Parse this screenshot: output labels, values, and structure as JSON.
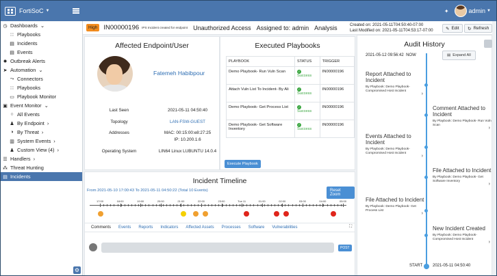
{
  "app": {
    "brand": "FortiSoC",
    "user": "admin"
  },
  "sidebar": {
    "items": [
      {
        "label": "Dashboards",
        "icon": "dashboard-icon",
        "sub": false,
        "active": false
      },
      {
        "label": "Playbooks",
        "icon": "playbooks-icon",
        "sub": true,
        "active": false
      },
      {
        "label": "Incidents",
        "icon": "incidents-icon",
        "sub": true,
        "active": false
      },
      {
        "label": "Events",
        "icon": "events-icon",
        "sub": true,
        "active": false
      },
      {
        "label": "Outbreak Alerts",
        "icon": "outbreak-icon",
        "sub": false,
        "active": false
      },
      {
        "label": "Automation",
        "icon": "automation-icon",
        "sub": false,
        "active": false
      },
      {
        "label": "Connectors",
        "icon": "connectors-icon",
        "sub": true,
        "active": false
      },
      {
        "label": "Playbooks",
        "icon": "playbooks-icon",
        "sub": true,
        "active": false
      },
      {
        "label": "Playbook Monitor",
        "icon": "monitor-icon",
        "sub": true,
        "active": false
      },
      {
        "label": "Event Monitor",
        "icon": "event-monitor-icon",
        "sub": false,
        "active": false
      },
      {
        "label": "All Events",
        "icon": "circle-icon",
        "sub": true,
        "active": false
      },
      {
        "label": "By Endpoint",
        "icon": "endpoint-icon",
        "sub": true,
        "active": false
      },
      {
        "label": "By Threat",
        "icon": "threat-icon",
        "sub": true,
        "active": false
      },
      {
        "label": "System Events",
        "icon": "system-events-icon",
        "sub": true,
        "active": false
      },
      {
        "label": "Custom View (4)",
        "icon": "custom-view-icon",
        "sub": true,
        "active": false
      },
      {
        "label": "Handlers",
        "icon": "handlers-icon",
        "sub": false,
        "active": false
      },
      {
        "label": "Threat Hunting",
        "icon": "threat-hunting-icon",
        "sub": false,
        "active": false
      },
      {
        "label": "Incidents",
        "icon": "incidents-icon",
        "sub": false,
        "active": true
      }
    ]
  },
  "incident": {
    "severity": "High",
    "id": "IN00000196",
    "subtitle": "IPS Incident created for endpoint",
    "title": "Unauthorized Access",
    "assigned": "Assigned to: admin",
    "phase": "Analysis",
    "created": "Created on: 2021-05-11T04:50:40-07:00",
    "modified": "Last Modified on: 2021-05-11T04:53:17-07:00",
    "edit_label": "Edit",
    "refresh_label": "Refresh"
  },
  "endpoint": {
    "title": "Affected Endpoint/User",
    "name": "Fatemeh Habibpour",
    "fields": [
      {
        "key": "Last Seen",
        "value": "2021-05-11 04:50:40"
      },
      {
        "key": "Topology",
        "value": "LAN-FSW-GUEST"
      },
      {
        "key": "Addresses",
        "value": "MAC: 00:15:00:e8:27:25"
      },
      {
        "key": "",
        "value": "IP: 10.200.1.6"
      },
      {
        "key": "Operating System",
        "value": "LIN64 Linux LUBUNTU 14.0.4"
      }
    ]
  },
  "playbooks": {
    "title": "Executed Playbooks",
    "headers": [
      "PLAYBOOK",
      "STATUS",
      "TRIGGER"
    ],
    "rows": [
      {
        "playbook": "Demo Playbook- Run Vuln Scan",
        "status": "Success",
        "trigger": "IN00000196"
      },
      {
        "playbook": "Attach Vuln List To Incident- By Ali",
        "status": "Success",
        "trigger": "IN00000196"
      },
      {
        "playbook": "Demo Playbook- Get Process List",
        "status": "Success",
        "trigger": "IN00000196"
      },
      {
        "playbook": "Demo Playbook- Get Software Inventory",
        "status": "Success",
        "trigger": "IN00000196"
      }
    ],
    "execute_label": "Execute Playbook"
  },
  "timeline": {
    "title": "Incident Timeline",
    "range": "From 2021-05-10 17:00:43 To 2021-05-11 04:50:22 (Total 10 Events)",
    "reset_label": "Reset Zoom",
    "ticks": [
      "17:00",
      "18:00",
      "19:00",
      "20:00",
      "21:00",
      "22:00",
      "23:00",
      "Tue 11",
      "01:00",
      "02:00",
      "03:00",
      "04:00",
      "05:00"
    ],
    "colors": {
      "red": "#e0251b",
      "orange": "#f0a030",
      "yellow": "#f5d000"
    }
  },
  "tabs": [
    "Comments",
    "Events",
    "Reports",
    "Indicators",
    "Affected Assets",
    "Processes",
    "Software",
    "Vulnerabilities"
  ],
  "comment": {
    "post_label": "POST"
  },
  "audit": {
    "title": "Audit History",
    "now_time": "2021-05-12 09:56:42",
    "now_label": "NOW",
    "expand_label": "Expand All",
    "entries": [
      {
        "title": "Report Attached to Incident",
        "sub": "By Playbook: Demo Playbook- Compromised Host Incident"
      },
      {
        "title": "Comment Attached to Incident",
        "sub": "By Playbook: Demo Playbook- Run Vuln Scan"
      },
      {
        "title": "Events Attached to Incident",
        "sub": "By Playbook: Demo Playbook- Compromised Host Incident"
      },
      {
        "title": "File Attached to Incident",
        "sub": "By Playbook: Demo Playbook- Get Software Inventory"
      },
      {
        "title": "File Attached to Incident",
        "sub": "By Playbook: Demo Playbook- Get Process List"
      },
      {
        "title": "New Incident Created",
        "sub": "By Playbook: Demo Playbook- Compromised Host Incident"
      }
    ],
    "start_label": "START",
    "start_time": "2021-05-11 04:50:40"
  }
}
